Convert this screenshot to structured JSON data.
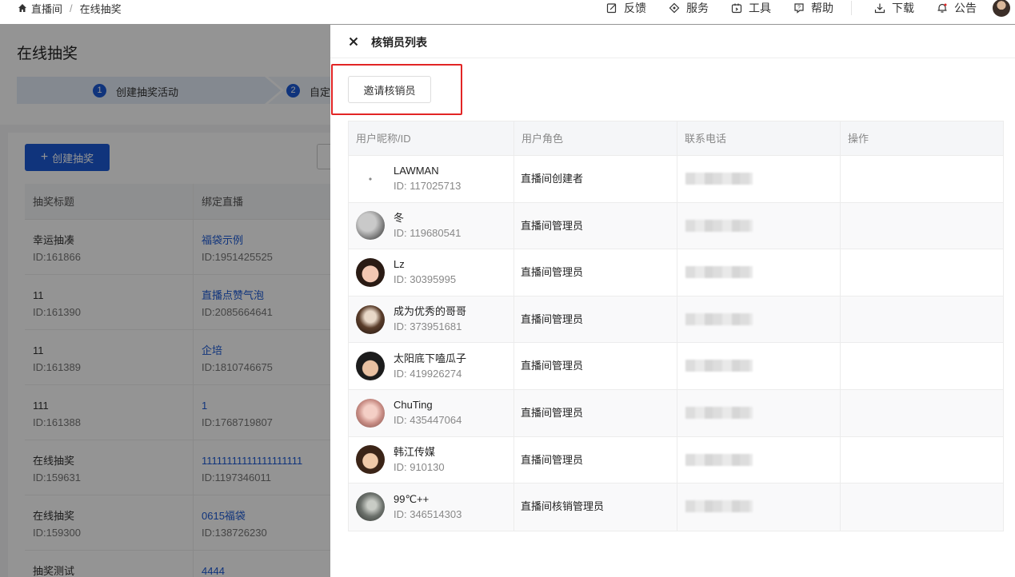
{
  "breadcrumb": {
    "home": "直播间",
    "current": "在线抽奖"
  },
  "topnav": [
    {
      "label": "反馈",
      "icon": "feedback-icon"
    },
    {
      "label": "服务",
      "icon": "service-icon"
    },
    {
      "label": "工具",
      "icon": "tools-icon"
    },
    {
      "label": "帮助",
      "icon": "help-icon"
    },
    {
      "label": "下载",
      "icon": "download-icon"
    },
    {
      "label": "公告",
      "icon": "bell-icon"
    }
  ],
  "background": {
    "title": "在线抽奖",
    "steps": [
      {
        "num": "1",
        "label": "创建抽奖活动"
      },
      {
        "num": "2",
        "label": "自定"
      }
    ],
    "create_button": "创建抽奖",
    "table": {
      "headers": [
        "抽奖标题",
        "绑定直播"
      ],
      "rows": [
        {
          "title": "幸运抽凑",
          "id": "ID:161866",
          "live": "福袋示例",
          "live_id": "ID:1951425525"
        },
        {
          "title": "11",
          "id": "ID:161390",
          "live": "直播点赞气泡",
          "live_id": "ID:2085664641"
        },
        {
          "title": "11",
          "id": "ID:161389",
          "live": "企培",
          "live_id": "ID:1810746675"
        },
        {
          "title": "111",
          "id": "ID:161388",
          "live": "1",
          "live_id": "ID:1768719807"
        },
        {
          "title": "在线抽奖",
          "id": "ID:159631",
          "live": "11111111111111111111",
          "live_id": "ID:1197346011"
        },
        {
          "title": "在线抽奖",
          "id": "ID:159300",
          "live": "0615福袋",
          "live_id": "ID:138726230"
        },
        {
          "title": "抽奖测试",
          "id": "",
          "live": "4444",
          "live_id": ""
        }
      ]
    }
  },
  "drawer": {
    "title": "核销员列表",
    "invite_button": "邀请核销员",
    "columns": [
      "用户昵称/ID",
      "用户角色",
      "联系电话",
      "操作"
    ],
    "rows": [
      {
        "name": "LAWMAN",
        "id": "ID: 117025713",
        "role": "直播间创建者"
      },
      {
        "name": "冬",
        "id": "ID: 119680541",
        "role": "直播间管理员"
      },
      {
        "name": "Lz",
        "id": "ID: 30395995",
        "role": "直播间管理员"
      },
      {
        "name": "成为优秀的哥哥",
        "id": "ID: 373951681",
        "role": "直播间管理员"
      },
      {
        "name": "太阳底下嗑瓜子",
        "id": "ID: 419926274",
        "role": "直播间管理员"
      },
      {
        "name": "ChuTing",
        "id": "ID: 435447064",
        "role": "直播间管理员"
      },
      {
        "name": "韩江传媒",
        "id": "ID: 910130",
        "role": "直播间管理员"
      },
      {
        "name": "99℃++",
        "id": "ID: 346514303",
        "role": "直播间核销管理员"
      }
    ]
  },
  "colors": {
    "primary": "#1d5bd6",
    "highlight": "#e22525"
  }
}
